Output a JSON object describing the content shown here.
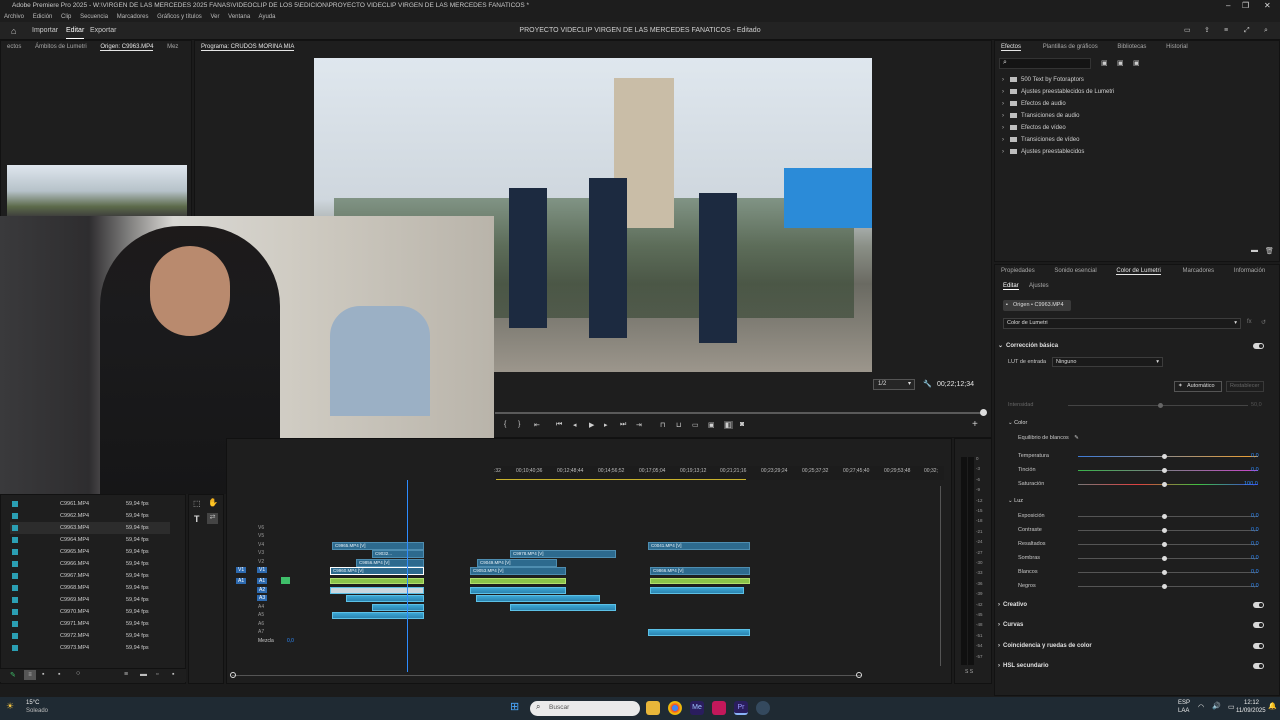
{
  "window": {
    "title": "Adobe Premiere Pro 2025 - W:\\VIRGEN DE LAS MERCEDES 2025 FANAS\\VIDEOCLIP DE LOS 5\\EDICION\\PROYECTO VIDECLIP VIRGEN DE LAS MERCEDES FANATICOS *",
    "menu": [
      "Archivo",
      "Edición",
      "Clip",
      "Secuencia",
      "Marcadores",
      "Gráficos y títulos",
      "Ver",
      "Ventana",
      "Ayuda"
    ]
  },
  "appbar": {
    "tabs": [
      "Importar",
      "Editar",
      "Exportar"
    ],
    "active_tab": "Editar",
    "project_title": "PROYECTO VIDECLIP VIRGEN DE LAS MERCEDES FANATICOS - Editado"
  },
  "source_panel": {
    "tabs": [
      "ectos",
      "Ámbitos de Lumetri",
      "Origen: C9963.MP4",
      "Mez"
    ]
  },
  "program_panel": {
    "title": "Programa: CRUDOS MORINA MIA",
    "zoom": "1/2",
    "timecode": "00;22;12;34"
  },
  "effects_panel": {
    "tabs": [
      "Efectos",
      "Plantillas de gráficos",
      "Bibliotecas",
      "Historial"
    ],
    "items": [
      "500 Text by Fotoraptors",
      "Ajustes preestablecidos de Lumetri",
      "Efectos de audio",
      "Transiciones de audio",
      "Efectos de vídeo",
      "Transiciones de vídeo",
      "Ajustes preestablecidos"
    ]
  },
  "lumetri_panel": {
    "tabs": [
      "Propiedades",
      "Sonido esencial",
      "Color de Lumetri",
      "Marcadores",
      "Información"
    ],
    "subtabs": [
      "Editar",
      "Ajustes"
    ],
    "source_chip": "Origen • C9963.MP4",
    "effect_select": "Color de Lumetri",
    "basic_correction": "Corrección básica",
    "lut_label": "LUT de entrada",
    "lut_value": "Ninguno",
    "auto_button": "Automático",
    "reset_button": "Restablecer",
    "intensity_label": "Intensidad",
    "intensity_value": "50,0",
    "color_header": "Color",
    "white_balance": "Equilibrio de blancos",
    "color_rows": [
      {
        "label": "Temperatura",
        "value": "0,0"
      },
      {
        "label": "Tinción",
        "value": "0,0"
      },
      {
        "label": "Saturación",
        "value": "100,0"
      }
    ],
    "light_header": "Luz",
    "light_rows": [
      {
        "label": "Exposición",
        "value": "0,0"
      },
      {
        "label": "Contraste",
        "value": "0,0"
      },
      {
        "label": "Resaltados",
        "value": "0,0"
      },
      {
        "label": "Sombras",
        "value": "0,0"
      },
      {
        "label": "Blancos",
        "value": "0,0"
      },
      {
        "label": "Negros",
        "value": "0,0"
      }
    ],
    "sections": [
      "Creativo",
      "Curvas",
      "Coincidencia y ruedas de color",
      "HSL secundario"
    ]
  },
  "project_panel": {
    "items": [
      {
        "name": "C9961.MP4",
        "fps": "59,94 fps"
      },
      {
        "name": "C9962.MP4",
        "fps": "59,94 fps"
      },
      {
        "name": "C9963.MP4",
        "fps": "59,94 fps"
      },
      {
        "name": "C9964.MP4",
        "fps": "59,94 fps"
      },
      {
        "name": "C9965.MP4",
        "fps": "59,94 fps"
      },
      {
        "name": "C9966.MP4",
        "fps": "59,94 fps"
      },
      {
        "name": "C9967.MP4",
        "fps": "59,94 fps"
      },
      {
        "name": "C9968.MP4",
        "fps": "59,94 fps"
      },
      {
        "name": "C9969.MP4",
        "fps": "59,94 fps"
      },
      {
        "name": "C9970.MP4",
        "fps": "59,94 fps"
      },
      {
        "name": "C9971.MP4",
        "fps": "59,94 fps"
      },
      {
        "name": "C9972.MP4",
        "fps": "59,94 fps"
      },
      {
        "name": "C9973.MP4",
        "fps": "59,94 fps"
      }
    ]
  },
  "timeline": {
    "ruler": [
      ":32",
      "00;10;40;36",
      "00;12;48;44",
      "00;14;56;52",
      "00;17;05;04",
      "00;19;13;12",
      "00;21;21;16",
      "00;23;29;24",
      "00;25;37;32",
      "00;27;45;40",
      "00;29;53;48",
      "00;32;"
    ],
    "video_tracks": [
      "V6",
      "V5",
      "V4",
      "V3",
      "V2",
      "V1"
    ],
    "audio_tracks": [
      "A1",
      "A2",
      "A3",
      "A4",
      "A5",
      "A6",
      "A7"
    ],
    "mix_label": "Mezcla",
    "mix_value": "0,0",
    "clips": [
      "C9965.MP4 [V]",
      "C9032...",
      "C9856.MP4 [V]",
      "C9960.MP4 [V]",
      "C9978.MP4 [V]",
      "C9049.MP4 [V]",
      "C9053.MP4 [V]",
      "C0041.MP4 [V]",
      "C9866.MP4 [V]"
    ]
  },
  "meters": [
    "0",
    "-3",
    "-6",
    "-9",
    "-12",
    "-15",
    "-18",
    "-21",
    "-24",
    "-27",
    "-30",
    "-33",
    "-36",
    "-39",
    "-42",
    "-45",
    "-48",
    "-51",
    "-54",
    "-57"
  ],
  "meter_footer": "S S",
  "taskbar": {
    "weather_temp": "15°C",
    "weather_text": "Soleado",
    "search_placeholder": "Buscar",
    "lang": "ESP",
    "lang2": "LAA",
    "time": "12:12",
    "date": "11/09/2025"
  }
}
